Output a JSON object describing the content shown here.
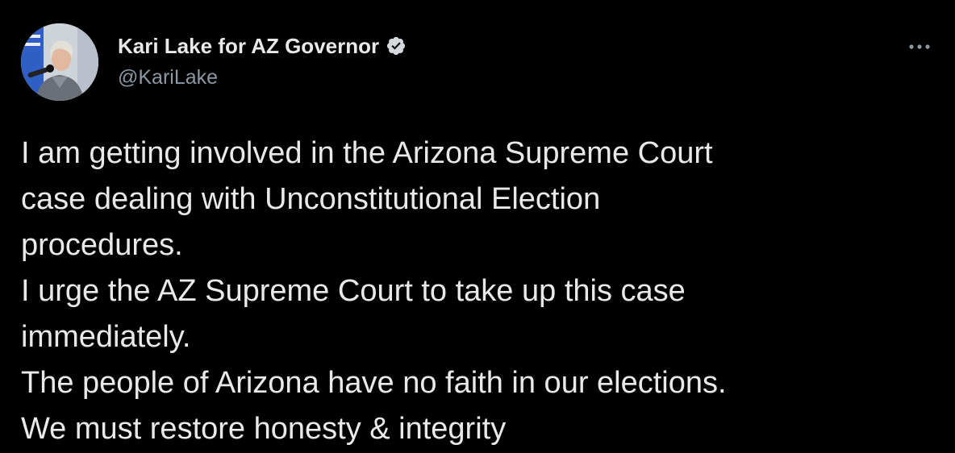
{
  "header": {
    "display_name": "Kari Lake for AZ Governor",
    "handle": "@KariLake",
    "avatar_icon": "profile-photo",
    "verified_icon": "verified-badge-icon",
    "more_icon": "more-options-icon"
  },
  "tweet": {
    "lines": [
      "I am getting involved in the Arizona Supreme Court",
      "case dealing with Unconstitutional Election",
      "procedures.",
      "I urge the AZ Supreme Court to take up this case",
      "immediately.",
      "The people of Arizona have no faith in our elections.",
      "We must restore honesty & integrity"
    ]
  },
  "colors": {
    "background": "#000000",
    "text_primary": "#e7e9ea",
    "text_secondary": "#8b98a5",
    "verified_badge": "#d5d9dd"
  }
}
